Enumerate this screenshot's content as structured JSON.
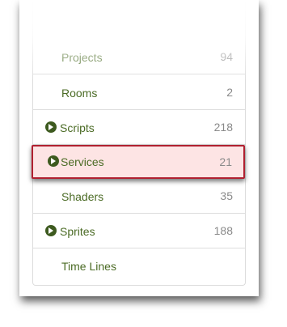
{
  "list": {
    "items": [
      {
        "label": "Projects",
        "count": "94",
        "expandable": false
      },
      {
        "label": "Rooms",
        "count": "2",
        "expandable": false
      },
      {
        "label": "Scripts",
        "count": "218",
        "expandable": true
      },
      {
        "label": "Services",
        "count": "21",
        "expandable": true,
        "selected": true
      },
      {
        "label": "Shaders",
        "count": "35",
        "expandable": false
      },
      {
        "label": "Sprites",
        "count": "188",
        "expandable": true
      },
      {
        "label": "Time Lines",
        "count": "",
        "expandable": false
      }
    ]
  },
  "icons": {
    "expand": "chevron-right-circle-icon"
  },
  "colors": {
    "text": "#4b6b25",
    "count": "#8a8a8a",
    "selected_bg": "#fde4e4",
    "selected_border": "#b02030",
    "toggle": "#3d5a1f"
  }
}
